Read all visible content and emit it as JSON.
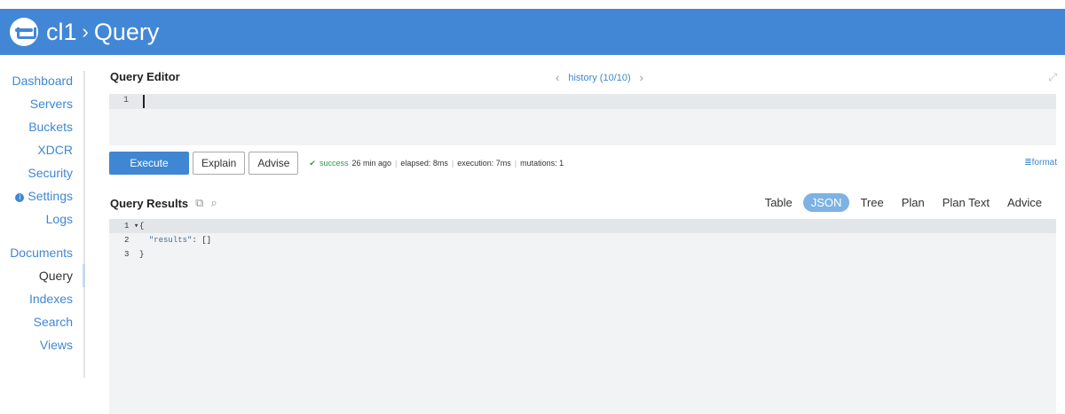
{
  "header": {
    "cluster": "cl1",
    "separator": "›",
    "page": "Query"
  },
  "sidebar": {
    "items": [
      "Dashboard",
      "Servers",
      "Buckets",
      "XDCR",
      "Security",
      "Settings",
      "Logs",
      "Documents",
      "Query",
      "Indexes",
      "Search",
      "Views"
    ],
    "info_badge": "i",
    "active": "Query"
  },
  "editor": {
    "title": "Query Editor",
    "history_label": "history (10/10)",
    "line_number": "1",
    "query_text": ""
  },
  "toolbar": {
    "execute": "Execute",
    "explain": "Explain",
    "advise": "Advise",
    "status_icon": "✔",
    "status": "success",
    "time_ago": "26 min ago",
    "elapsed": "elapsed: 8ms",
    "execution": "execution: 7ms",
    "mutations": "mutations: 1",
    "format": "format"
  },
  "results": {
    "title": "Query Results",
    "tabs": [
      "Table",
      "JSON",
      "Tree",
      "Plan",
      "Plan Text",
      "Advice"
    ],
    "active_tab": "JSON",
    "lines": [
      {
        "n": "1",
        "marker": "▾",
        "text": "{"
      },
      {
        "n": "2",
        "marker": "",
        "key": "\"results\"",
        "text": ": []"
      },
      {
        "n": "3",
        "marker": "",
        "text": "}"
      }
    ]
  },
  "colors": {
    "brand": "#4287d6",
    "link": "#3f87d3",
    "success": "#2f9a4b",
    "active_tab": "#7db2e3"
  }
}
